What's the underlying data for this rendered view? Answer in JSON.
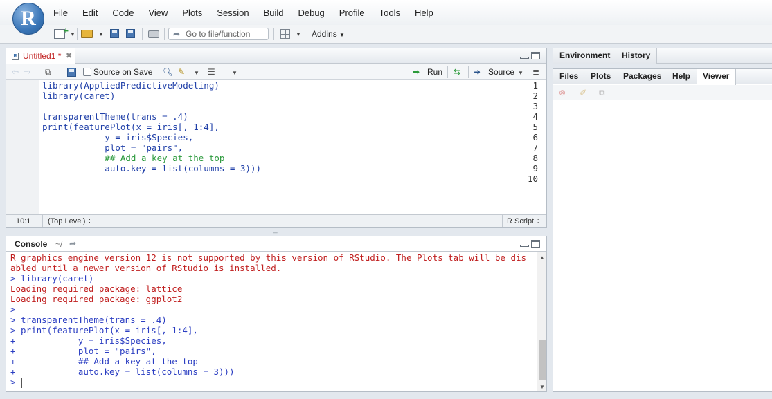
{
  "app": {
    "logo_letter": "R",
    "menu": [
      "File",
      "Edit",
      "Code",
      "View",
      "Plots",
      "Session",
      "Build",
      "Debug",
      "Profile",
      "Tools",
      "Help"
    ]
  },
  "toolbar": {
    "goto_placeholder": "Go to file/function",
    "addins_label": "Addins"
  },
  "editor": {
    "tab_label": "Untitled1 *",
    "source_on_save": "Source on Save",
    "run_label": "Run",
    "source_label": "Source",
    "lines": [
      {
        "n": "1",
        "code": "library(AppliedPredictiveModeling)"
      },
      {
        "n": "2",
        "code": "library(caret)"
      },
      {
        "n": "3",
        "code": ""
      },
      {
        "n": "4",
        "code": "transparentTheme(trans = .4)"
      },
      {
        "n": "5",
        "code": "print(featurePlot(x = iris[, 1:4],"
      },
      {
        "n": "6",
        "code": "            y = iris$Species,"
      },
      {
        "n": "7",
        "code": "            plot = \"pairs\","
      },
      {
        "n": "8",
        "code": "            ## Add a key at the top"
      },
      {
        "n": "9",
        "code": "            auto.key = list(columns = 3)))"
      },
      {
        "n": "10",
        "code": ""
      }
    ],
    "status_position": "10:1",
    "status_scope": "(Top Level) ÷",
    "status_type": "R Script ÷"
  },
  "console": {
    "title": "Console",
    "path": "~/",
    "lines": [
      {
        "kind": "err",
        "text": "R graphics engine version 12 is not supported by this version of RStudio. The Plots tab will be dis"
      },
      {
        "kind": "err",
        "text": "abled until a newer version of RStudio is installed."
      },
      {
        "kind": "cmd",
        "text": "> library(caret)"
      },
      {
        "kind": "err",
        "text": "Loading required package: lattice"
      },
      {
        "kind": "err",
        "text": "Loading required package: ggplot2"
      },
      {
        "kind": "cmd",
        "text": ">"
      },
      {
        "kind": "cmd",
        "text": "> transparentTheme(trans = .4)"
      },
      {
        "kind": "cmd",
        "text": "> print(featurePlot(x = iris[, 1:4],"
      },
      {
        "kind": "cmd",
        "text": "+            y = iris$Species,"
      },
      {
        "kind": "cmd",
        "text": "+            plot = \"pairs\","
      },
      {
        "kind": "cmd",
        "text": "+            ## Add a key at the top"
      },
      {
        "kind": "cmd",
        "text": "+            auto.key = list(columns = 3)))"
      },
      {
        "kind": "cmd",
        "text": "> "
      }
    ]
  },
  "right_top_tabs": [
    "Environment",
    "History"
  ],
  "right_bottom_tabs": [
    "Files",
    "Plots",
    "Packages",
    "Help",
    "Viewer"
  ],
  "right_bottom_active": "Viewer",
  "colors": {
    "error_text": "#c01f1f",
    "command_text": "#2b3ec2",
    "code_text": "#1f3fa8",
    "comment_text": "#2c9a3d"
  }
}
